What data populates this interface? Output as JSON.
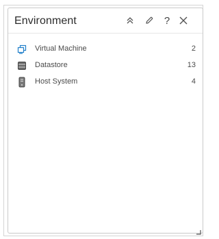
{
  "widget": {
    "title": "Environment",
    "header_buttons": {
      "collapse_icon": "double-chevron-up-icon",
      "edit_icon": "pencil-icon",
      "help_label": "?",
      "close_icon": "close-icon"
    }
  },
  "inventory": {
    "items": [
      {
        "label": "Virtual Machine",
        "count": "2",
        "icon": "virtual-machine-icon"
      },
      {
        "label": "Datastore",
        "count": "13",
        "icon": "datastore-icon"
      },
      {
        "label": "Host System",
        "count": "4",
        "icon": "host-system-icon"
      }
    ]
  },
  "colors": {
    "vm_icon": "#1f7ec9",
    "storage_icon": "#555555",
    "border": "#c9c9c9"
  }
}
